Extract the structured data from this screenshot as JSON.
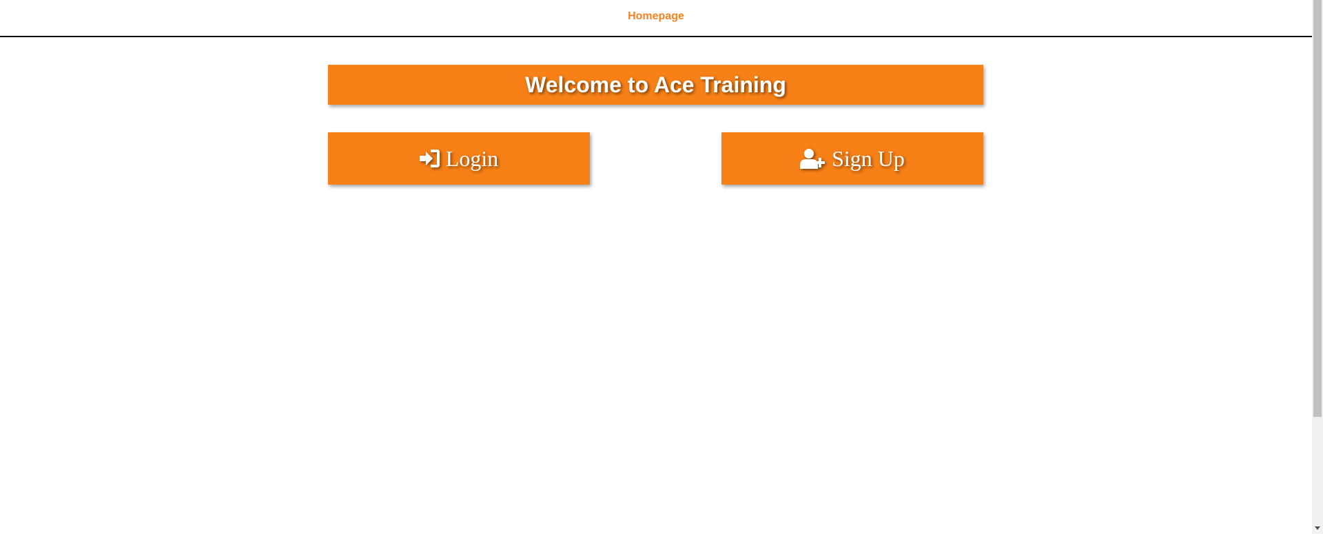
{
  "nav": {
    "homepage_label": "Homepage"
  },
  "banner": {
    "title": "Welcome to Ace Training"
  },
  "actions": {
    "login": {
      "label": "Login",
      "icon": "sign-in-icon"
    },
    "signup": {
      "label": "Sign Up",
      "icon": "user-plus-icon"
    }
  },
  "colors": {
    "accent": "#f78117",
    "nav_link": "#f58220",
    "text_on_accent": "#ffffff"
  }
}
